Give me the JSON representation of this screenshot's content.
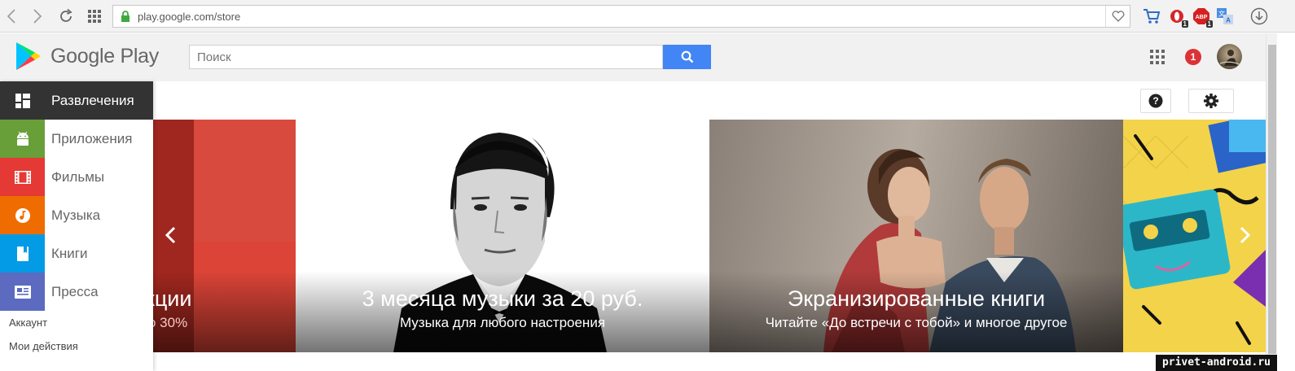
{
  "browser": {
    "url": "play.google.com/store",
    "icons": [
      "back-icon",
      "forward-icon",
      "reload-icon",
      "speed-dial-icon",
      "lock-icon",
      "heart-icon",
      "cart-icon",
      "opera-icon",
      "adblock-icon",
      "translate-icon",
      "download-icon"
    ],
    "badges": {
      "opera": "1",
      "adblock": "1"
    }
  },
  "header": {
    "logo_text": "Google Play",
    "search_placeholder": "Поиск",
    "notifications": "1"
  },
  "sidebar": {
    "items": [
      {
        "label": "Развлечения",
        "icon": "home-grid-icon",
        "color": "#333333"
      },
      {
        "label": "Приложения",
        "icon": "android-icon",
        "color": "#689f38"
      },
      {
        "label": "Фильмы",
        "icon": "film-icon",
        "color": "#e53935"
      },
      {
        "label": "Музыка",
        "icon": "music-note-icon",
        "color": "#ef6c00"
      },
      {
        "label": "Книги",
        "icon": "book-icon",
        "color": "#039be5"
      },
      {
        "label": "Пресса",
        "icon": "newspaper-icon",
        "color": "#5c6bc0"
      }
    ],
    "links": [
      "Аккаунт",
      "Мои действия"
    ]
  },
  "carousel": {
    "cards": [
      {
        "title": "кции",
        "subtitle": "о 30%",
        "color": "#db4437"
      },
      {
        "title": "3 месяца музыки за 20 руб.",
        "subtitle": "Музыка для любого настроения",
        "color": "#ffffff"
      },
      {
        "title": "Экранизированные книги",
        "subtitle": "Читайте «До встречи с тобой» и многое другое",
        "color": "#6b5f58"
      }
    ]
  },
  "watermark": "privet-android.ru"
}
